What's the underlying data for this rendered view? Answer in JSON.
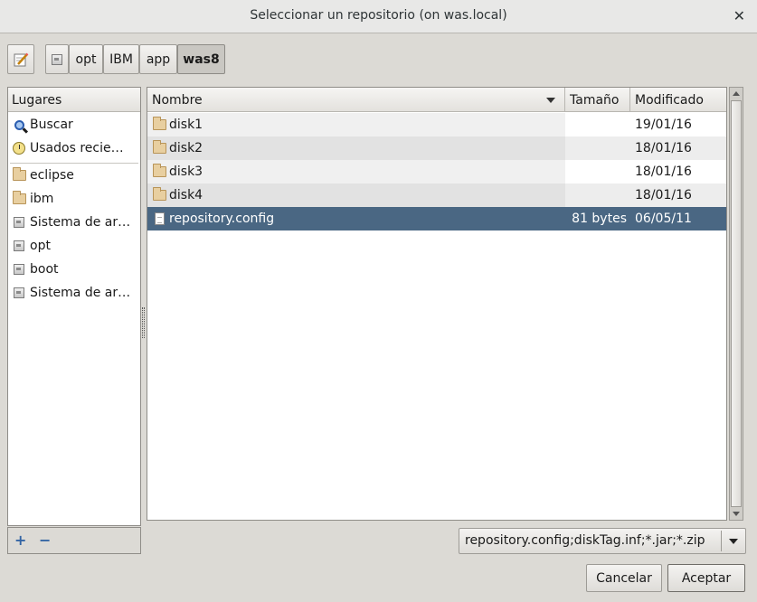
{
  "window": {
    "title": "Seleccionar un repositorio (on was.local)",
    "close_glyph": "✕"
  },
  "pathbar": {
    "edit_icon": "pencil-edit-icon",
    "crumbs": [
      "opt",
      "IBM",
      "app",
      "was8"
    ]
  },
  "places": {
    "header": "Lugares",
    "items": [
      {
        "label": "Buscar",
        "icon": "search-icon"
      },
      {
        "label": "Usados recie…",
        "icon": "recent-icon"
      },
      {
        "label": "eclipse",
        "icon": "folder-icon"
      },
      {
        "label": "ibm",
        "icon": "home-folder-icon"
      },
      {
        "label": "Sistema de ar…",
        "icon": "drive-icon"
      },
      {
        "label": "opt",
        "icon": "drive-icon"
      },
      {
        "label": "boot",
        "icon": "drive-icon"
      },
      {
        "label": "Sistema de ar…",
        "icon": "drive-icon"
      }
    ],
    "add_glyph": "+",
    "remove_glyph": "−"
  },
  "files": {
    "columns": {
      "name": "Nombre",
      "size": "Tamaño",
      "modified": "Modificado"
    },
    "rows": [
      {
        "name": "disk1",
        "size": "",
        "modified": "19/01/16",
        "type": "folder"
      },
      {
        "name": "disk2",
        "size": "",
        "modified": "18/01/16",
        "type": "folder"
      },
      {
        "name": "disk3",
        "size": "",
        "modified": "18/01/16",
        "type": "folder"
      },
      {
        "name": "disk4",
        "size": "",
        "modified": "18/01/16",
        "type": "folder"
      },
      {
        "name": "repository.config",
        "size": "81 bytes",
        "modified": "06/05/11",
        "type": "file",
        "selected": true
      }
    ]
  },
  "filter": {
    "value": "repository.config;diskTag.inf;*.jar;*.zip"
  },
  "buttons": {
    "cancel": "Cancelar",
    "accept": "Aceptar"
  },
  "colors": {
    "selection": "#4a6783",
    "background": "#dcdad5"
  }
}
